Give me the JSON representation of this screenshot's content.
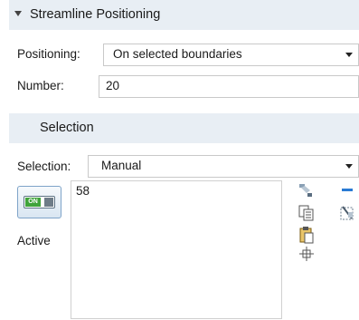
{
  "section_streamline": {
    "title": "Streamline Positioning"
  },
  "positioning": {
    "label": "Positioning:",
    "value": "On selected boundaries"
  },
  "number": {
    "label": "Number:",
    "value": "20"
  },
  "section_selection": {
    "title": "Selection"
  },
  "selection": {
    "label": "Selection:",
    "value": "Manual",
    "items": [
      "58"
    ]
  },
  "active_toggle": {
    "badge": "ON",
    "label": "Active"
  },
  "icons": [
    "paint-selection-icon",
    "remove-icon",
    "copy-list-icon",
    "clear-selection-icon",
    "paste-icon",
    "zoom-to-selection-icon"
  ],
  "colors": {
    "section_header_bg": "#e8eef4",
    "toggle_on": "#3fa33a",
    "remove_icon": "#2a7bd4"
  }
}
